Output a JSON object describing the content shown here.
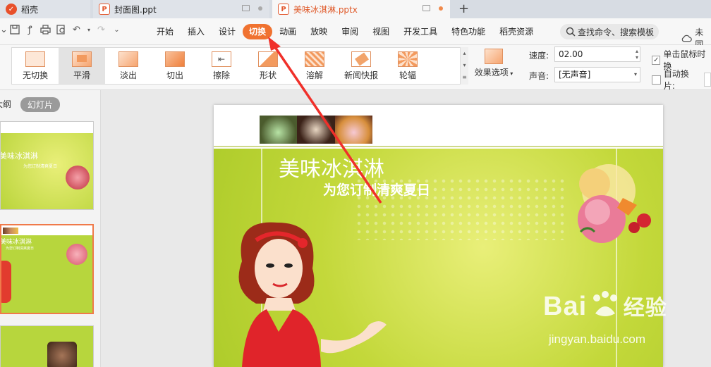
{
  "tabs": [
    {
      "label": "稻壳",
      "icon": "daoke-logo-icon"
    },
    {
      "label": "封面图.ppt",
      "icon": "ppt-file-icon"
    },
    {
      "label": "美味冰淇淋.pptx",
      "icon": "ppt-file-icon"
    }
  ],
  "menu": [
    "开始",
    "插入",
    "设计",
    "切换",
    "动画",
    "放映",
    "审阅",
    "视图",
    "开发工具",
    "特色功能",
    "稻壳资源"
  ],
  "active_menu": "切换",
  "search": {
    "label": "查找命令、搜索模板"
  },
  "cloud": {
    "label": "未同"
  },
  "effects": [
    "无切换",
    "平滑",
    "淡出",
    "切出",
    "擦除",
    "形状",
    "溶解",
    "新闻快报",
    "轮辐"
  ],
  "selected_effect": "平滑",
  "effect_options": {
    "label": "效果选项"
  },
  "speed": {
    "label": "速度:",
    "value": "02.00"
  },
  "sound": {
    "label": "声音:",
    "value": "[无声音]"
  },
  "checks": [
    {
      "label": "单击鼠标时换",
      "checked": true
    },
    {
      "label": "自动换片:",
      "checked": false
    }
  ],
  "panel": {
    "outline_tab": "大纲",
    "slides_tab": "幻灯片"
  },
  "slide": {
    "title": "美味冰淇淋",
    "subtitle": "为您订制清爽夏日"
  },
  "thumbs": [
    {
      "title": "美味冰淇淋",
      "subtitle": "为您订制清爽夏日"
    },
    {
      "title": "美味冰淇淋",
      "subtitle": "为您订制清爽夏日"
    }
  ],
  "watermark": {
    "brand": "Bai",
    "brand2": "经验",
    "url": "jingyan.baidu.com"
  },
  "colors": {
    "accent": "#f07230",
    "slide_green": "#c3d83a"
  }
}
